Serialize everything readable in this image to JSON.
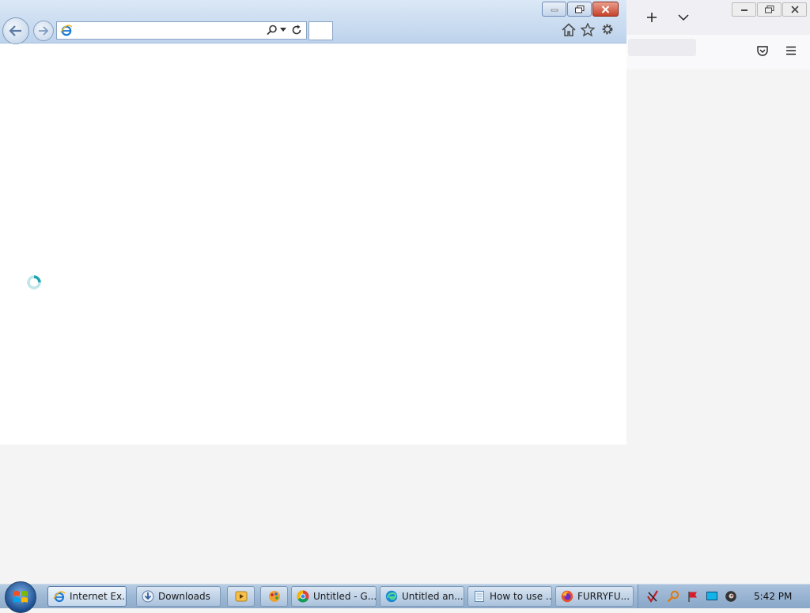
{
  "firefox_window": {
    "new_tab_icon": "plus-icon",
    "tab_list_icon": "chevron-down-icon",
    "pocket_icon": "pocket-icon",
    "menu_icon": "hamburger-menu-icon"
  },
  "ie_window": {
    "address": {
      "value": "",
      "placeholder": ""
    },
    "toolbar_icons": [
      "home-icon",
      "favorites-star-icon",
      "gear-icon"
    ],
    "status": "loading"
  },
  "taskbar": {
    "buttons": [
      {
        "label": "Internet Ex...",
        "icon": "ie-icon"
      },
      {
        "label": "Downloads",
        "icon": "downloads-icon"
      },
      {
        "label": "",
        "icon": "media-player-icon"
      },
      {
        "label": "",
        "icon": "paint-icon"
      },
      {
        "label": "Untitled - G...",
        "icon": "chrome-icon"
      },
      {
        "label": "Untitled an...",
        "icon": "edge-icon"
      },
      {
        "label": "How to use ...",
        "icon": "notepad-icon"
      },
      {
        "label": "FURRYFU...",
        "icon": "firefox-icon"
      }
    ],
    "clock": "5:42 PM",
    "colors": {
      "close_button": "#c6422a",
      "taskbar": "#9fbad6"
    }
  }
}
